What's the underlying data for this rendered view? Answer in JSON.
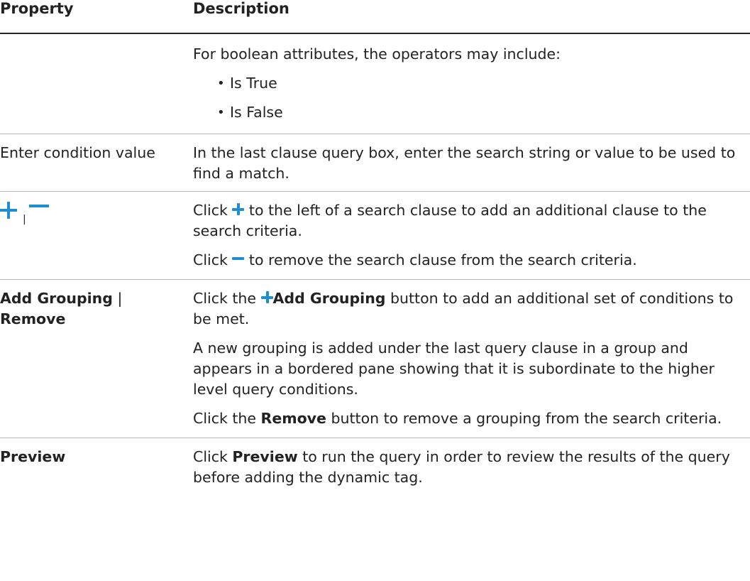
{
  "table": {
    "headers": {
      "property": "Property",
      "description": "Description"
    }
  },
  "rows": {
    "boolean_ops": {
      "intro": "For boolean attributes, the operators may include:",
      "items": [
        "Is True",
        "Is False"
      ]
    },
    "condition_value": {
      "property": "Enter condition value",
      "desc": "In the last clause query box, enter the search string or value to be used to find a match."
    },
    "plus_minus": {
      "separator": "|",
      "p1_pre": "Click",
      "p1_post": "to the left of a search clause to add an additional clause to the search criteria.",
      "p2_pre": "Click",
      "p2_post": "to remove the search clause from the search criteria."
    },
    "grouping": {
      "property_bold1": "Add Grouping",
      "property_sep": " | ",
      "property_bold2": "Remove",
      "p1_pre": "Click the",
      "p1_bold": "Add Grouping",
      "p1_post": "button to add an additional set of conditions to be met.",
      "p2": "A new grouping is added under the last query clause in a group and appears in a bordered pane showing that it is subordinate to the higher level query conditions.",
      "p3_pre": "Click the",
      "p3_bold": "Remove",
      "p3_post": "button to remove a grouping from the search criteria."
    },
    "preview": {
      "property": "Preview",
      "p_pre": "Click",
      "p_bold": "Preview",
      "p_post": "to run the query in order to review the results of the query before adding the dynamic tag."
    }
  },
  "icons": {
    "plus": "plus-icon",
    "minus": "minus-icon",
    "color": "#1d8fd0"
  }
}
